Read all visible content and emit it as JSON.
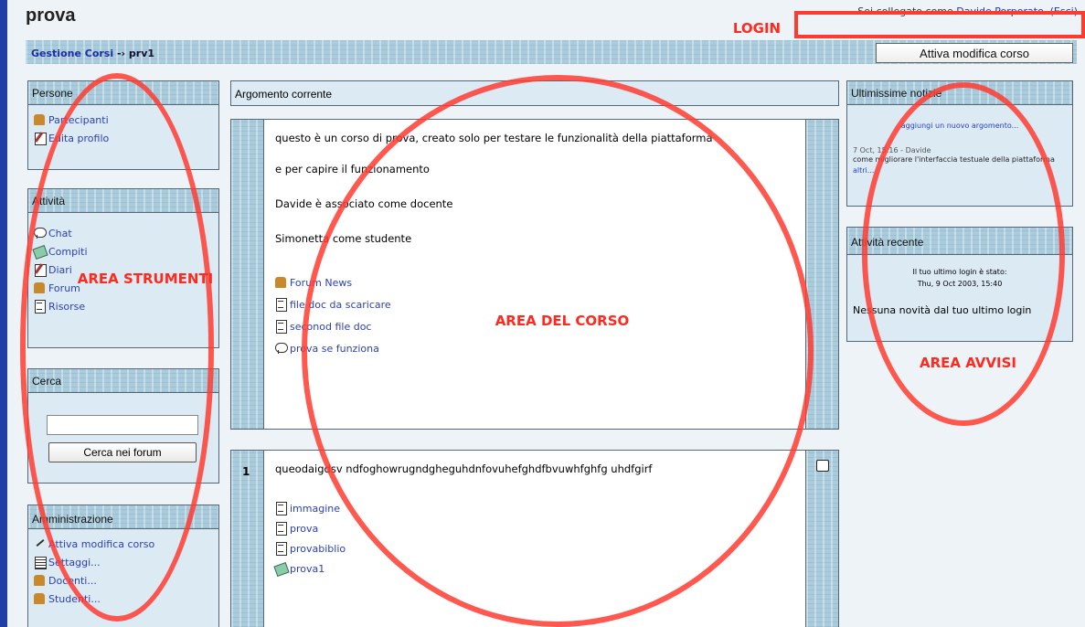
{
  "header": {
    "site_title": "prova",
    "login_text": "Sei collegato come",
    "login_user": "Davide Porporato.",
    "logout": "(Esci)"
  },
  "navbar": {
    "breadcrumb_root": "Gestione Corsi",
    "breadcrumb_sep": "-›",
    "breadcrumb_current": "prv1",
    "edit_button": "Attiva modifica corso"
  },
  "left": {
    "people": {
      "title": "Persone",
      "items": [
        "Partecipanti",
        "Edita profilo"
      ]
    },
    "activities": {
      "title": "Attività",
      "items": [
        "Chat",
        "Compiti",
        "Diari",
        "Forum",
        "Risorse"
      ]
    },
    "search": {
      "title": "Cerca",
      "input_value": "",
      "button": "Cerca nei forum"
    },
    "admin": {
      "title": "Amministrazione",
      "items": [
        "Attiva modifica corso",
        "Settaggi...",
        "Docenti...",
        "Studenti..."
      ]
    }
  },
  "center": {
    "current_topic_title": "Argomento corrente",
    "section0": {
      "paragraphs": [
        "questo è un corso di prova, creato solo per testare le funzionalità della piattaforma",
        "e per capire il funzionamento",
        "Davide è associato come docente",
        "Simonetta come studente"
      ],
      "links": [
        "Forum News",
        "file doc da scaricare",
        "seconod file doc",
        "prova se funziona"
      ]
    },
    "section1": {
      "number": "1",
      "text": "queodaigdsv ndfoghowrugndgheguhdnfovuhefghdfbvuwhfghfg uhdfgirf",
      "links": [
        "immagine",
        "prova",
        "provabiblio",
        "prova1"
      ]
    }
  },
  "right": {
    "news": {
      "title": "Ultimissime notizie",
      "add_link": "aggiungi un nuovo argomento...",
      "meta": "7 Oct, 15:16 - Davide",
      "text": "come migliorare l'interfaccia testuale della piattaforma",
      "more": "altri..."
    },
    "recent": {
      "title": "Attività recente",
      "login_label": "Il tuo ultimo login è stato:",
      "login_date": "Thu, 9 Oct 2003, 15:40",
      "no_news": "Nessuna novità dal tuo ultimo login"
    }
  },
  "annotations": {
    "login": "LOGIN",
    "tools": "AREA STRUMENTI",
    "course": "AREA DEL CORSO",
    "notices": "AREA AVVISI",
    "color": "#ff3b30"
  }
}
